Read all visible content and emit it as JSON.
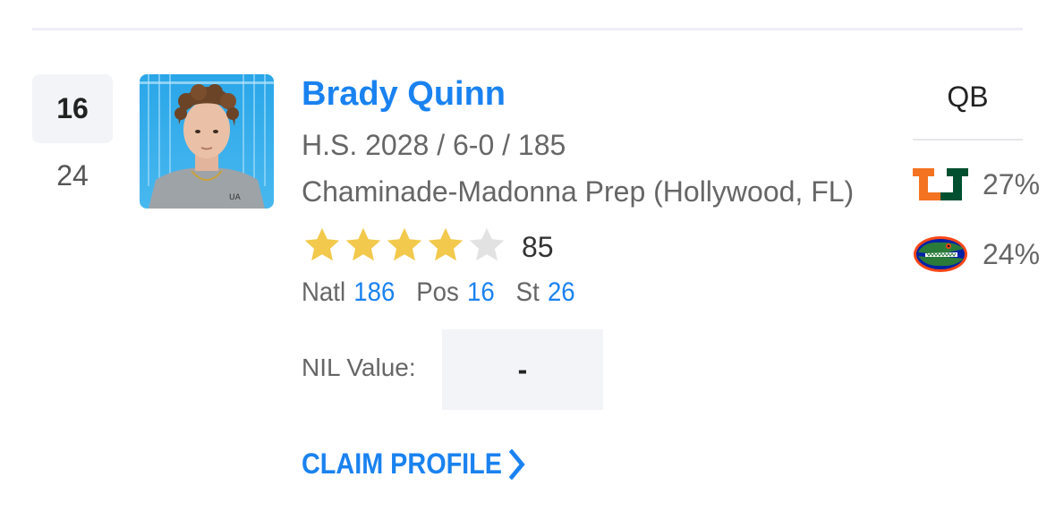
{
  "player": {
    "rank": "16",
    "previous_rank": "24",
    "name": "Brady Quinn",
    "bio": "H.S. 2028 / 6-0 / 185",
    "school": "Chaminade-Madonna Prep (Hollywood, FL)",
    "stars": 4,
    "max_stars": 5,
    "rating": "85",
    "position": "QB"
  },
  "rankings": {
    "natl_label": "Natl",
    "natl_value": "186",
    "pos_label": "Pos",
    "pos_value": "16",
    "st_label": "St",
    "st_value": "26"
  },
  "nil": {
    "label": "NIL Value:",
    "value": "-"
  },
  "claim_profile": {
    "label": "CLAIM PROFILE",
    "icon": "chevron-right-icon"
  },
  "predictions": [
    {
      "team_logo": "miami-u-logo-icon",
      "percent": "27%"
    },
    {
      "team_logo": "florida-gator-logo-icon",
      "percent": "24%"
    }
  ],
  "colors": {
    "accent_blue": "#1a82f0",
    "star_filled": "#f2c94c",
    "star_empty": "#e2e2e2",
    "miami_orange": "#f47321",
    "miami_green": "#005030",
    "florida_blue": "#0021a5",
    "florida_orange": "#fa4616"
  }
}
